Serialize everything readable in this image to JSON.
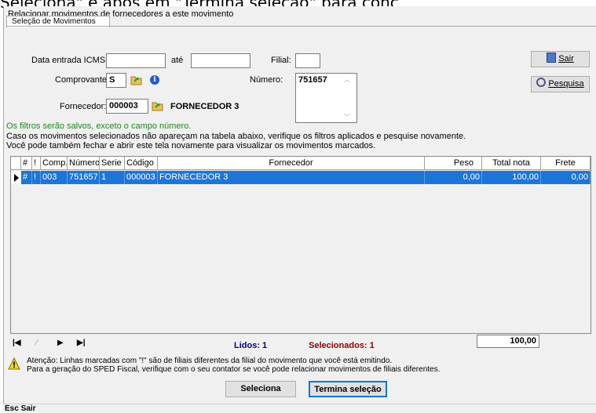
{
  "background_text": "Seleciona\" e após em \"Termina seleção\" para conc",
  "window": {
    "title": "Relacionar movimentos de fornecedores a este movimento"
  },
  "tab": {
    "label": "Seleção de Movimentos"
  },
  "filters": {
    "data_entrada_label": "Data entrada ICMS:",
    "data_entrada_value": "",
    "ate_label": "até",
    "ate_value": "",
    "filial_label": "Filial:",
    "filial_value": "",
    "comprovante_label": "Comprovante:",
    "comprovante_value": "S",
    "numero_label": "Número:",
    "numero_value": "751657",
    "fornecedor_label": "Fornecedor:",
    "fornecedor_value": "000003",
    "fornecedor_name": "FORNECEDOR 3"
  },
  "buttons": {
    "sair": "Sair",
    "pesquisa": "Pesquisa",
    "seleciona": "Seleciona",
    "termina": "Termina seleção"
  },
  "messages": {
    "filters_saved": "Os filtros serão salvos, exceto o campo número.",
    "line1": "Caso os movimentos selecionados não apareçam na tabela abaixo, verifique os filtros aplicados e pesquise novamente.",
    "line2": "Você pode também fechar e abrir este tela novamente para visualizar os movimentos marcados."
  },
  "table": {
    "headers": [
      "#",
      "!",
      "Comp.",
      "Número",
      "Serie",
      "Código",
      "Fornecedor",
      "Peso",
      "Total nota",
      "Frete"
    ],
    "rows": [
      [
        "#",
        "!",
        "003",
        "751657",
        "1",
        "000003",
        "FORNECEDOR 3",
        "0,00",
        "100,00",
        "0,00"
      ]
    ]
  },
  "footer": {
    "lidos_label": "Lidos: 1",
    "selecionados_label": "Selecionados: 1",
    "total": "100,00",
    "warning_line1": "Atenção: Linhas marcadas com \"!\" são de filiais diferentes da filial do movimento que você está emitindo.",
    "warning_line2": "Para a geração do SPED Fiscal, verifique com o seu contator se você pode relacionar movimentos de filiais diferentes."
  },
  "status": {
    "text": "Esc Sair"
  },
  "colors": {
    "selection": "#1e75d8",
    "green_text": "#1a8a1a",
    "dark_red": "#8b0000",
    "navy": "#000080"
  }
}
